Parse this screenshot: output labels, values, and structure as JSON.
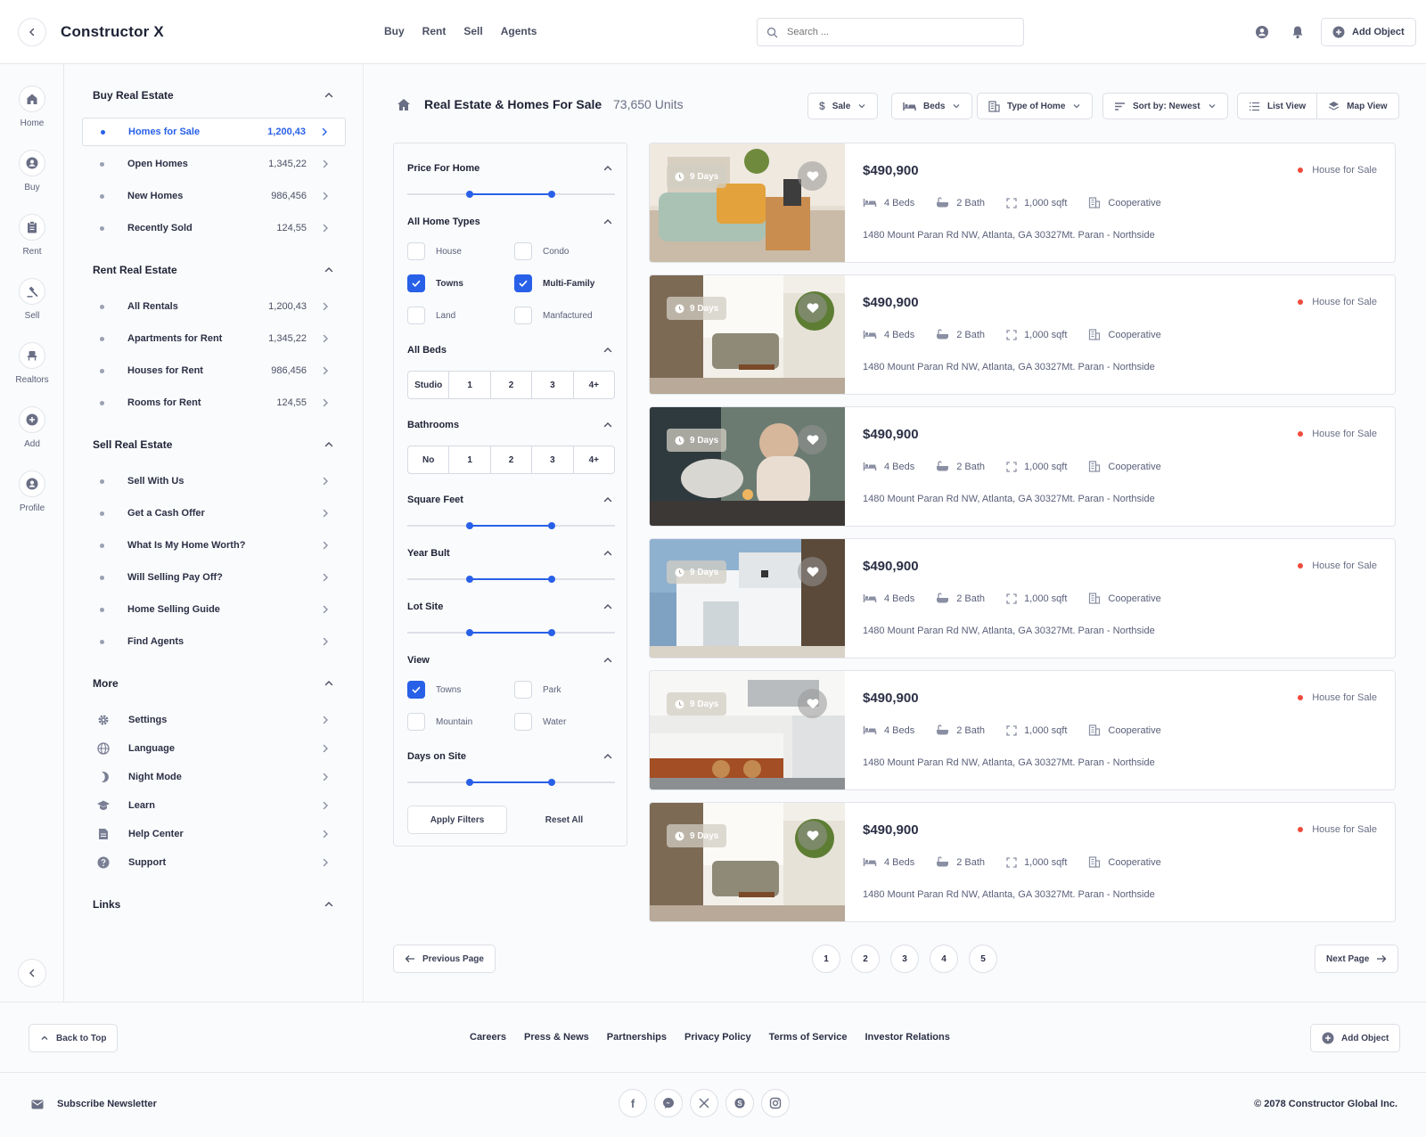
{
  "app": {
    "title": "Constructor X"
  },
  "nav": [
    "Buy",
    "Rent",
    "Sell",
    "Agents"
  ],
  "search": {
    "placeholder": "Search ..."
  },
  "header": {
    "add_object": "Add Object"
  },
  "rail": [
    "Home",
    "Buy",
    "Rent",
    "Sell",
    "Realtors",
    "Add",
    "Profile"
  ],
  "sidebar": {
    "buy": {
      "title": "Buy Real Estate",
      "items": [
        {
          "label": "Homes for Sale",
          "count": "1,200,43"
        },
        {
          "label": "Open Homes",
          "count": "1,345,22"
        },
        {
          "label": "New Homes",
          "count": "986,456"
        },
        {
          "label": "Recently Sold",
          "count": "124,55"
        }
      ]
    },
    "rent": {
      "title": "Rent Real Estate",
      "items": [
        {
          "label": "All Rentals",
          "count": "1,200,43"
        },
        {
          "label": "Apartments for Rent",
          "count": "1,345,22"
        },
        {
          "label": "Houses for Rent",
          "count": "986,456"
        },
        {
          "label": "Rooms for Rent",
          "count": "124,55"
        }
      ]
    },
    "sell": {
      "title": "Sell Real Estate",
      "items": [
        "Sell With Us",
        "Get a Cash Offer",
        "What Is My Home Worth?",
        "Will Selling Pay Off?",
        "Home Selling Guide",
        "Find Agents"
      ]
    },
    "more": {
      "title": "More",
      "items": [
        {
          "label": "Settings",
          "icon": "gear-icon"
        },
        {
          "label": "Language",
          "icon": "globe-icon"
        },
        {
          "label": "Night Mode",
          "icon": "moon-icon"
        },
        {
          "label": "Learn",
          "icon": "graduation-cap-icon"
        },
        {
          "label": "Help Center",
          "icon": "document-icon"
        },
        {
          "label": "Support",
          "icon": "question-icon"
        }
      ]
    },
    "links": {
      "title": "Links"
    }
  },
  "page": {
    "title": "Real Estate & Homes For Sale",
    "units": "73,650 Units"
  },
  "toolbar": {
    "sale": "Sale",
    "beds": "Beds",
    "type": "Type of Home",
    "sort": "Sort by: Newest",
    "list_view": "List View",
    "map_view": "Map View"
  },
  "filters": {
    "price": "Price For Home",
    "home_types": {
      "title": "All Home Types",
      "options": [
        {
          "label": "House",
          "checked": false
        },
        {
          "label": "Condo",
          "checked": false
        },
        {
          "label": "Towns",
          "checked": true
        },
        {
          "label": "Multi-Family",
          "checked": true
        },
        {
          "label": "Land",
          "checked": false
        },
        {
          "label": "Manfactured",
          "checked": false
        }
      ]
    },
    "beds": {
      "title": "All Beds",
      "options": [
        "Studio",
        "1",
        "2",
        "3",
        "4+"
      ]
    },
    "baths": {
      "title": "Bathrooms",
      "options": [
        "No",
        "1",
        "2",
        "3",
        "4+"
      ]
    },
    "sqft": "Square Feet",
    "year": "Year Bult",
    "lot": "Lot Site",
    "view": {
      "title": "View",
      "options": [
        {
          "label": "Towns",
          "checked": true
        },
        {
          "label": "Park",
          "checked": false
        },
        {
          "label": "Mountain",
          "checked": false
        },
        {
          "label": "Water",
          "checked": false
        }
      ]
    },
    "days": "Days on Site",
    "apply": "Apply Filters",
    "reset": "Reset All"
  },
  "listing": {
    "days": "9 Days",
    "price": "$490,900",
    "tag": "House for Sale",
    "beds": "4 Beds",
    "bath": "2 Bath",
    "sqft": "1,000 sqft",
    "type": "Cooperative",
    "address": "1480 Mount Paran Rd NW, Atlanta, GA 30327Mt. Paran - Northside"
  },
  "pagination": {
    "prev": "Previous Page",
    "next": "Next Page",
    "pages": [
      "1",
      "2",
      "3",
      "4",
      "5"
    ]
  },
  "footer": {
    "back_to_top": "Back to Top",
    "links": [
      "Careers",
      "Press & News",
      "Partnerships",
      "Privacy Policy",
      "Terms of Service",
      "Investor Relations"
    ],
    "add_object": "Add Object",
    "newsletter": "Subscribe Newsletter",
    "copyright": "© 2078 Constructor Global Inc."
  },
  "colors": {
    "accent": "#2860e8",
    "status_dot": "#ef4b3c"
  }
}
